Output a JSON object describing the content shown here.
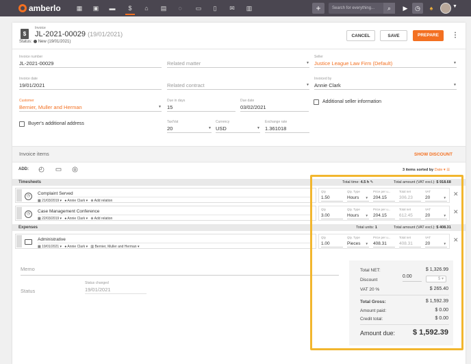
{
  "brand": {
    "name": "amberlo",
    "accent": "#f37021",
    "highlight": "#f2b62e"
  },
  "topbar": {
    "search_placeholder": "Search for everything..."
  },
  "nav_icons": [
    "dashboard-icon",
    "contacts-icon",
    "briefcase-icon",
    "invoice-icon",
    "bank-icon",
    "calendar-icon",
    "chat-icon",
    "folder-icon",
    "document-icon",
    "mail-icon",
    "reports-icon"
  ],
  "header": {
    "doc_label": "Invoice",
    "number": "JL-2021-00029",
    "number_date": "(19/01/2021)",
    "status_prefix": "Status:",
    "status_text": "New (19/01/2021)",
    "cancel": "CANCEL",
    "save": "SAVE",
    "prepare": "PREPARE"
  },
  "form": {
    "invoice_number_label": "Invoice number",
    "invoice_number": "JL-2021-00029",
    "related_matter": "Related matter",
    "seller_label": "Seller",
    "seller": "Justice League Law Firm (Default)",
    "invoice_date_label": "Invoice date",
    "invoice_date": "19/01/2021",
    "related_contract": "Related contract",
    "invoiced_by_label": "Invoiced by",
    "invoiced_by": "Annie Clark",
    "customer_label": "Customer",
    "customer": "Bernier, Muller and Herman",
    "due_days_label": "Due in days",
    "due_days": "15",
    "due_date_label": "Due date",
    "due_date": "03/02/2021",
    "additional_seller": "Additional seller information",
    "buyers_address": "Buyer's additional address",
    "tax_label": "Tax/Vat",
    "tax": "20",
    "currency_label": "Currency",
    "currency": "USD",
    "exchange_label": "Exchange rate",
    "exchange": "1.361018"
  },
  "items": {
    "title": "Invoice items",
    "show_discount": "SHOW DISCOUNT",
    "add_label": "ADD:",
    "sorted_count": "3 items sorted by",
    "sorted_field": "Date",
    "timesheets": {
      "name": "Timesheets",
      "total_time_label": "Total time:",
      "total_time": "4.5 h",
      "total_amount_label": "Total amount (VAT excl.):",
      "total_amount": "$ 918.68"
    },
    "expenses": {
      "name": "Expenses",
      "total_units_label": "Total units:",
      "total_units": "1",
      "total_amount_label": "Total amount (VAT excl.):",
      "total_amount": "$ 408.31"
    },
    "col_labels": {
      "qty": "Qty",
      "qty_type": "Qty. Type",
      "price": "Price per u...",
      "total": "Total net",
      "vat": "VAT"
    },
    "rows": [
      {
        "title": "Complaint Served",
        "date": "21/03/2019",
        "user": "Annie Clark",
        "extra": "Add relation",
        "qty": "1.50",
        "qty_type": "Hours",
        "price": "204.15",
        "total": "306.23",
        "vat": "20"
      },
      {
        "title": "Case Management Conference",
        "date": "22/03/2019",
        "user": "Annie Clark",
        "extra": "Add relation",
        "qty": "3.00",
        "qty_type": "Hours",
        "price": "204.15",
        "total": "612.45",
        "vat": "20"
      },
      {
        "title": "Administrative",
        "date": "19/01/2021",
        "user": "Annie Clark",
        "extra": "Bernier, Muller and Herman",
        "qty": "1.00",
        "qty_type": "Pieces",
        "price": "408.31",
        "total": "408.31",
        "vat": "20"
      }
    ]
  },
  "memo": {
    "label": "Memo"
  },
  "status_block": {
    "label": "Status",
    "changed_label": "Status changed",
    "changed": "19/01/2021"
  },
  "totals": {
    "net_label": "Total NET:",
    "net": "$ 1,326.99",
    "discount_label": "Discount",
    "discount": "0.00",
    "discount_currency": "$",
    "vat_label": "VAT 20 %",
    "vat": "$ 265.40",
    "gross_label": "Total Gross:",
    "gross": "$ 1,592.39",
    "paid_label": "Amount paid:",
    "paid": "$ 0.00",
    "credit_label": "Credit total:",
    "credit": "$ 0.00",
    "due_label": "Amount due:",
    "due": "$ 1,592.39"
  }
}
